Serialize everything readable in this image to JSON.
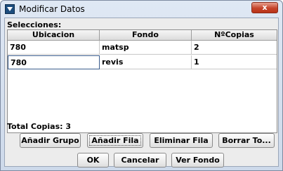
{
  "window": {
    "title": "Modificar Datos",
    "close_label": "x"
  },
  "selections_label": "Selecciones:",
  "table": {
    "columns": [
      "Ubicacion",
      "Fondo",
      "NºCopias"
    ],
    "rows": [
      [
        "780",
        "matsp",
        "2"
      ],
      [
        "780",
        "revis",
        "1"
      ]
    ]
  },
  "total_label": "Total Copias: 3",
  "buttons_row1": [
    "Añadir Grupo",
    "Añadir Fila",
    "Eliminar Fila",
    "Borrar To..."
  ],
  "buttons_row2": [
    "OK",
    "Cancelar",
    "Ver Fondo"
  ]
}
